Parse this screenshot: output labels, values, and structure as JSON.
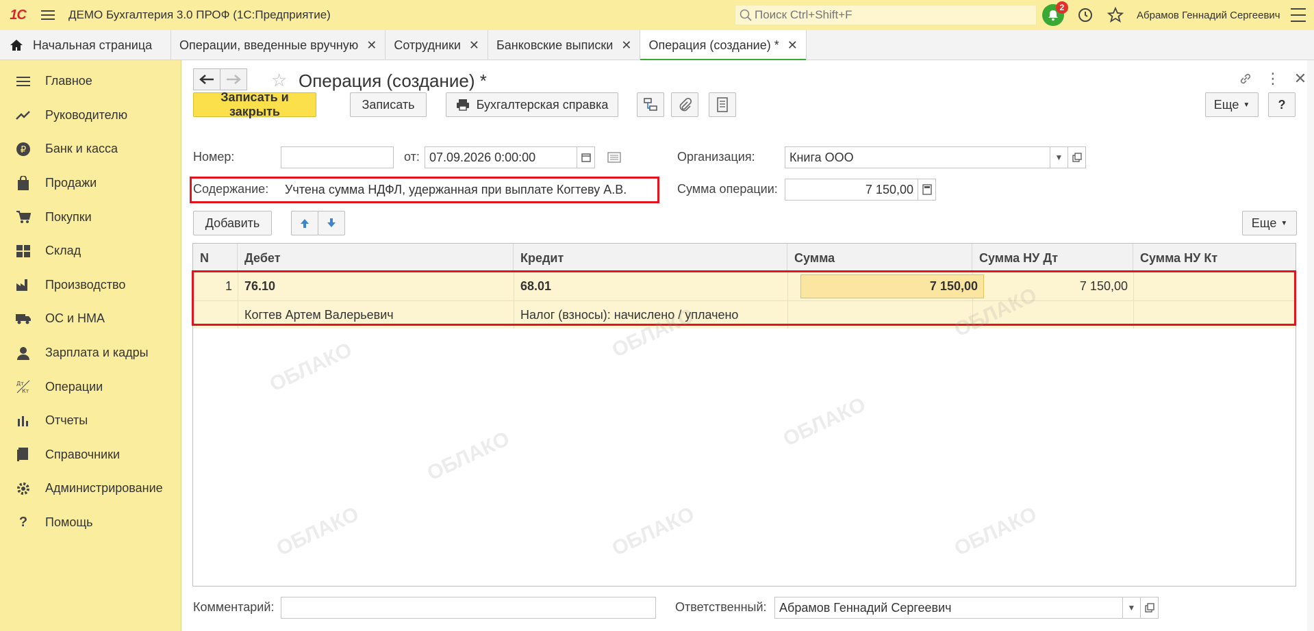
{
  "topbar": {
    "logo": "1С",
    "title": "ДЕМО Бухгалтерия 3.0 ПРОФ  (1С:Предприятие)",
    "search_placeholder": "Поиск Ctrl+Shift+F",
    "notifications_count": "2",
    "user": "Абрамов Геннадий Сергеевич"
  },
  "tabs": [
    {
      "label": "Начальная страница"
    },
    {
      "label": "Операции, введенные вручную"
    },
    {
      "label": "Сотрудники"
    },
    {
      "label": "Банковские выписки"
    },
    {
      "label": "Операция (создание) *"
    }
  ],
  "sidebar": {
    "items": [
      {
        "label": "Главное",
        "icon": "menu-lines-icon"
      },
      {
        "label": "Руководителю",
        "icon": "trend-icon"
      },
      {
        "label": "Банк и касса",
        "icon": "ruble-coin-icon"
      },
      {
        "label": "Продажи",
        "icon": "shopping-bag-icon"
      },
      {
        "label": "Покупки",
        "icon": "cart-icon"
      },
      {
        "label": "Склад",
        "icon": "warehouse-icon"
      },
      {
        "label": "Производство",
        "icon": "factory-icon"
      },
      {
        "label": "ОС и НМА",
        "icon": "truck-icon"
      },
      {
        "label": "Зарплата и кадры",
        "icon": "person-icon"
      },
      {
        "label": "Операции",
        "icon": "dt-kt-icon"
      },
      {
        "label": "Отчеты",
        "icon": "bar-chart-icon"
      },
      {
        "label": "Справочники",
        "icon": "books-icon"
      },
      {
        "label": "Администрирование",
        "icon": "gear-icon"
      },
      {
        "label": "Помощь",
        "icon": "question-icon"
      }
    ]
  },
  "form": {
    "title": "Операция (создание) *",
    "buttons": {
      "save_close": "Записать и закрыть",
      "save": "Записать",
      "report": "Бухгалтерская справка",
      "more": "Еще",
      "help": "?",
      "add": "Добавить",
      "more2": "Еще"
    },
    "number_label": "Номер:",
    "number_value": "",
    "date_label": "от:",
    "date_value": "07.09.2026  0:00:00",
    "org_label": "Организация:",
    "org_value": "Книга ООО",
    "content_label": "Содержание:",
    "content_value": "Учтена сумма НДФЛ, удержанная при выплате Когтеву А.В.",
    "sum_label": "Сумма операции:",
    "sum_value": "7 150,00",
    "comment_label": "Комментарий:",
    "comment_value": "",
    "responsible_label": "Ответственный:",
    "responsible_value": "Абрамов Геннадий Сергеевич"
  },
  "table": {
    "columns": [
      "N",
      "Дебет",
      "Кредит",
      "Сумма",
      "Сумма НУ Дт",
      "Сумма НУ Кт"
    ],
    "rows": [
      {
        "n": "1",
        "debit": "76.10",
        "debit_sub": "Когтев Артем Валерьевич",
        "credit": "68.01",
        "credit_sub": "Налог (взносы): начислено / уплачено",
        "sum": "7 150,00",
        "sum_nu_dt": "7 150,00",
        "sum_nu_kt": ""
      }
    ]
  },
  "watermark": "ОБЛАКО",
  "colors": {
    "accent_yellow": "#fbed9e",
    "primary_button": "#fbe04b",
    "highlight_frame": "#e3141e",
    "active_tab": "#3aa835"
  }
}
